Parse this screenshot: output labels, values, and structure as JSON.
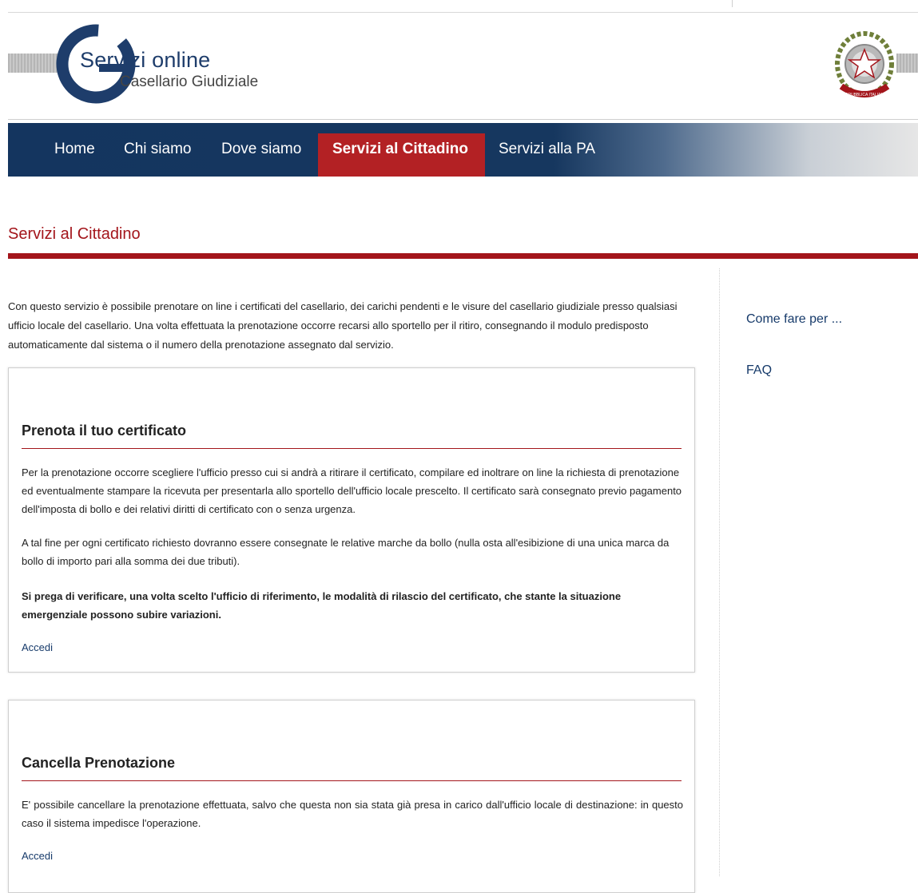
{
  "header": {
    "logo_title": "Servizi online",
    "logo_subtitle": "Casellario Giudiziale",
    "emblem_text": "REPUBBLICA ITALIANA"
  },
  "nav": {
    "items": [
      {
        "label": "Home"
      },
      {
        "label": "Chi siamo"
      },
      {
        "label": "Dove siamo"
      },
      {
        "label": "Servizi al Cittadino",
        "active": true
      },
      {
        "label": "Servizi alla PA"
      }
    ]
  },
  "page": {
    "title": "Servizi al Cittadino",
    "intro": "Con questo servizio è possibile prenotare on line i certificati del casellario, dei carichi pendenti e le visure del casellario giudiziale presso qualsiasi ufficio locale del casellario. Una volta effettuata la prenotazione occorre recarsi allo sportello per il ritiro, consegnando il modulo predisposto automaticamente dal sistema o il numero della prenotazione assegnato dal servizio."
  },
  "cards": [
    {
      "title": "Prenota il tuo certificato",
      "paragraphs": [
        "Per la prenotazione occorre scegliere l'ufficio presso cui si andrà a ritirare il certificato, compilare ed inoltrare on line la richiesta di prenotazione ed eventualmente stampare la ricevuta per presentarla allo sportello dell'ufficio locale prescelto. Il certificato sarà consegnato previo pagamento dell'imposta di bollo e dei relativi diritti di certificato con o senza  urgenza.",
        "A tal fine per ogni certificato richiesto dovranno essere consegnate  le relative marche da bollo (nulla osta all'esibizione di una unica marca da bollo di importo pari alla somma dei due tributi).",
        "Si prega di verificare, una volta scelto l'ufficio di riferimento, le modalità di rilascio del certificato, che stante la situazione emergenziale possono subire variazioni."
      ],
      "link": "Accedi"
    },
    {
      "title": "Cancella Prenotazione",
      "paragraphs": [
        "E' possibile cancellare la prenotazione effettuata, salvo che questa non sia stata già presa in carico  dall'ufficio locale di destinazione: in questo caso il sistema impedisce l'operazione."
      ],
      "link": "Accedi"
    }
  ],
  "sidebar": {
    "links": [
      {
        "label": "Come fare per ..."
      },
      {
        "label": "FAQ"
      }
    ]
  },
  "colors": {
    "brand_red": "#a3151b",
    "nav_blue": "#14355f",
    "nav_active": "#b32124",
    "link_blue": "#163a6a"
  }
}
